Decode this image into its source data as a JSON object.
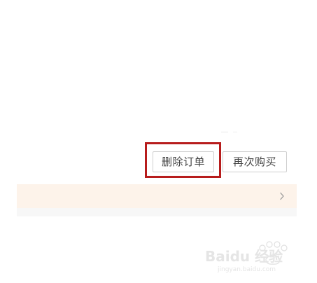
{
  "actions": {
    "delete_order_label": "删除订单",
    "rebuy_label": "再次购买"
  },
  "notice_bar": {
    "chevron_icon": "chevron-right-icon"
  },
  "watermark": {
    "brand": "Baidu 经验",
    "domain": "jingyan.baidu.com"
  },
  "colors": {
    "highlight": "#b71c1c",
    "notice_bg": "#fdf3ea",
    "button_border": "#cfcfcf",
    "button_text": "#444444"
  }
}
